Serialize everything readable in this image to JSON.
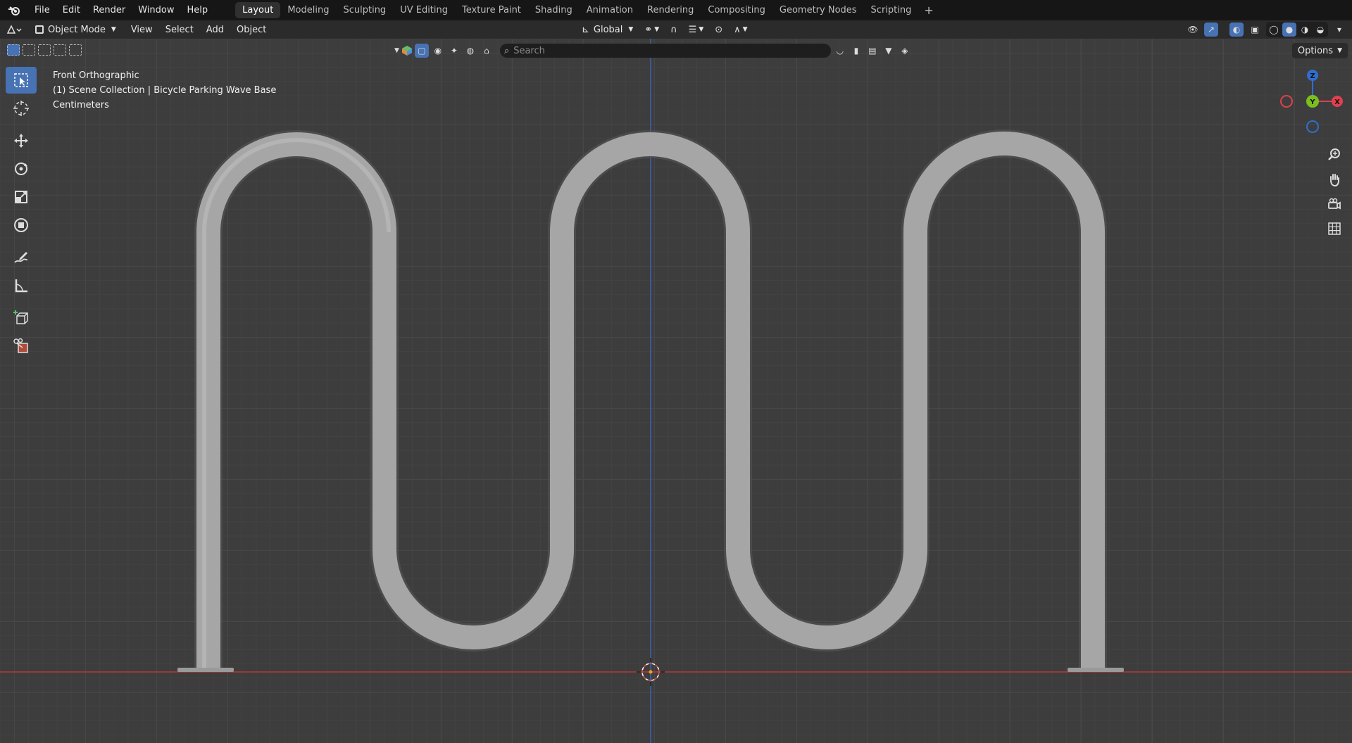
{
  "topbar": {
    "menus": [
      "File",
      "Edit",
      "Render",
      "Window",
      "Help"
    ],
    "workspaces": [
      "Layout",
      "Modeling",
      "Sculpting",
      "UV Editing",
      "Texture Paint",
      "Shading",
      "Animation",
      "Rendering",
      "Compositing",
      "Geometry Nodes",
      "Scripting"
    ],
    "active_workspace": "Layout",
    "add_workspace": "+"
  },
  "header": {
    "mode": "Object Mode",
    "menus": [
      "View",
      "Select",
      "Add",
      "Object"
    ],
    "transform_orientation": "Global"
  },
  "outliner": {
    "search_placeholder": "Search",
    "options_label": "Options"
  },
  "viewport": {
    "view_name": "Front Orthographic",
    "collection_info": "(1) Scene Collection | Bicycle Parking Wave Base",
    "units": "Centimeters"
  },
  "gizmo": {
    "z_label": "Z",
    "y_label": "Y",
    "x_label": "X",
    "z_color": "#2f6fd0",
    "y_color": "#7bbf1e",
    "x_color": "#e0404f"
  },
  "colors": {
    "accent": "#4772b3",
    "x_axis": "#b33a3a",
    "z_axis": "#3b63b0",
    "object": "#a6a6a6"
  }
}
